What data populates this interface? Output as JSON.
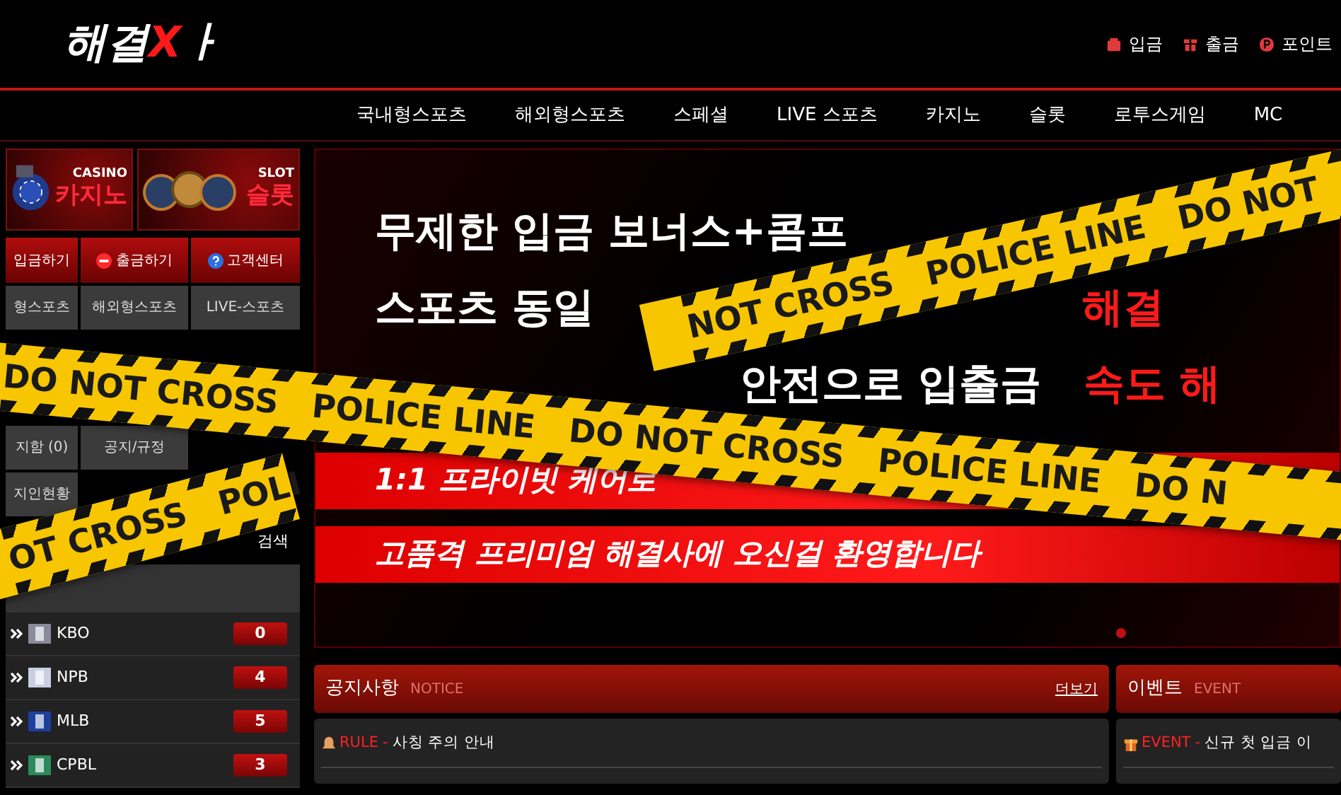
{
  "header": {
    "logo": [
      {
        "text": "해결",
        "color": "#ffffff"
      },
      {
        "text": "X",
        "color": "#ff1a1a"
      },
      {
        "text": "ㅏ",
        "color": "#ffffff"
      }
    ],
    "links": [
      {
        "kind": "deposit",
        "label": "입금"
      },
      {
        "kind": "withdraw",
        "label": "출금"
      },
      {
        "kind": "point",
        "label": "포인트"
      }
    ]
  },
  "nav": [
    "국내형스포츠",
    "해외형스포츠",
    "스페셜",
    "LIVE 스포츠",
    "카지노",
    "슬롯",
    "로투스게임",
    "MC"
  ],
  "sidebar": {
    "banners": [
      {
        "kind": "casino",
        "caption": "CASINO",
        "title": "카지노"
      },
      {
        "kind": "slot",
        "caption": "SLOT",
        "title": "슬롯"
      }
    ],
    "actions": [
      {
        "kind": "deposit",
        "label": "입금하기"
      },
      {
        "kind": "withdraw",
        "label": "출금하기"
      },
      {
        "kind": "support",
        "label": "고객센터"
      }
    ],
    "menu_rows": [
      {
        "cells": [
          {
            "label": "형스포츠"
          },
          {
            "label": "해외형스포츠"
          },
          {
            "label": "LIVE-스포츠"
          }
        ]
      },
      {
        "cells": [
          {},
          {},
          {}
        ]
      },
      {
        "cells": [
          {},
          {},
          {}
        ]
      },
      {
        "cells": [
          {
            "label": "지함 (0)"
          },
          {
            "label": "공지/규정"
          },
          {}
        ]
      },
      {
        "cells": [
          {
            "label": "지인현황"
          }
        ]
      }
    ],
    "search_button": "검색",
    "leagues": [
      {
        "name": "KBO",
        "count": "0"
      },
      {
        "name": "NPB",
        "count": "4"
      },
      {
        "name": "MLB",
        "count": "5"
      },
      {
        "name": "CPBL",
        "count": "3"
      }
    ]
  },
  "banner": {
    "lines": [
      {
        "kind": "plain",
        "parts": [
          {
            "text": "무제한 입금 보너스+콤프",
            "color": "#ffffff"
          }
        ]
      },
      {
        "kind": "plain",
        "parts": [
          {
            "text": "스포츠 동일",
            "color": "#ffffff"
          },
          {
            "text": "해결",
            "color": "#ff1a1a"
          }
        ]
      },
      {
        "kind": "plain",
        "parts": [
          {
            "text": "안전으로 입출금",
            "color": "#ffffff"
          },
          {
            "text": "속도 해",
            "color": "#ff1a1a"
          }
        ]
      },
      {
        "kind": "bar",
        "parts": [
          {
            "text": "1:1 프라이빗 케어로",
            "color": "#ffffff"
          }
        ]
      },
      {
        "kind": "bar",
        "parts": [
          {
            "text": "고품격 프리미엄 해결사에 오신걸 환영합니다",
            "color": "#ffffff"
          }
        ]
      }
    ]
  },
  "notice": {
    "title": "공지사항",
    "subtitle": "NOTICE",
    "more": "더보기",
    "items": [
      {
        "kind": "rule",
        "tag": "RULE",
        "separator": "-",
        "text": "사칭 주의 안내"
      }
    ]
  },
  "event": {
    "title": "이벤트",
    "subtitle": "EVENT",
    "items": [
      {
        "kind": "event",
        "tag": "EVENT",
        "separator": "-",
        "text": "신규 첫 입금 이"
      }
    ]
  },
  "tapes": [
    {
      "words": [
        "NOT CROSS",
        "POLICE LINE",
        "DO NOT"
      ]
    },
    {
      "words": [
        "OT CROSS",
        "POLI"
      ]
    },
    {
      "words": [
        "DO NOT CROSS",
        "POLICE LINE",
        "DO NOT CROSS",
        "POLICE LINE",
        "DO N"
      ]
    }
  ]
}
